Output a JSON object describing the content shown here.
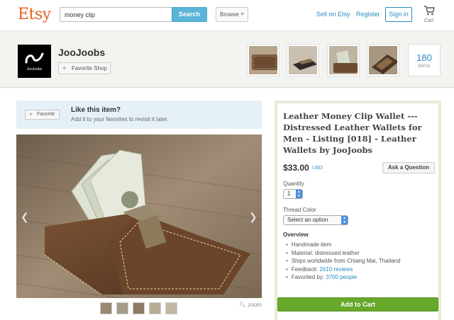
{
  "header": {
    "logo": "Etsy",
    "search_value": "money clip",
    "search_button": "Search",
    "browse": "Browse",
    "sell_link": "Sell on Etsy",
    "register_link": "Register",
    "signin_button": "Sign in",
    "cart_label": "Cart"
  },
  "shop": {
    "name": "JooJoobs",
    "logo_text": "JooJoobs",
    "favorite_button": "Favorite Shop",
    "items_count": "180",
    "items_label": "items"
  },
  "like": {
    "favorite_button": "Favorite",
    "title": "Like this item?",
    "subtitle": "Add it to your favorites to revisit it later."
  },
  "listing": {
    "title": "Leather Money Clip Wallet --- Distressed Leather Wallets for Men - Listing [018] - Leather Wallets by JooJoobs",
    "price": "$33.00",
    "currency": "USD",
    "ask_button": "Ask a Question",
    "quantity_label": "Quantity",
    "quantity_value": "1",
    "thread_label": "Thread Color",
    "thread_value": "Select an option",
    "overview_heading": "Overview",
    "overview": {
      "handmade": "Handmade item",
      "material": "Material: distressed leather",
      "ships": "Ships worldwide from Chiang Mai, Thailand",
      "feedback_label": "Feedback: ",
      "feedback_link": "2610 reviews",
      "favorited_label": "Favorited by: ",
      "favorited_link": "3700 people"
    },
    "add_to_cart": "Add to Cart",
    "zoom": "zoom"
  },
  "colors": {
    "etsy_orange": "#e86121",
    "link_blue": "#2a8bc0",
    "cart_green": "#67a82b",
    "like_bg": "#e5f1f7"
  }
}
